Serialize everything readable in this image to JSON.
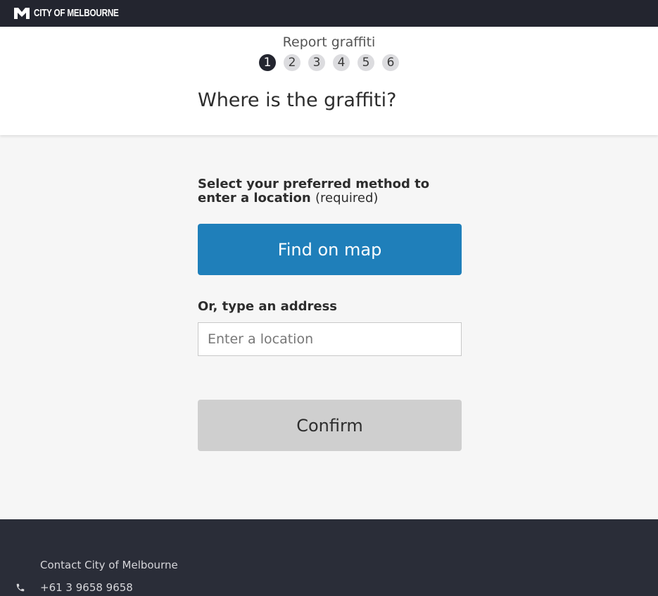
{
  "site": {
    "brand_name": "CITY OF MELBOURNE",
    "logo_icon": "melbourne-m-logo-icon"
  },
  "form": {
    "title": "Report graffiti",
    "steps": [
      "1",
      "2",
      "3",
      "4",
      "5",
      "6"
    ],
    "current_step": 1,
    "question": "Where is the graffiti?"
  },
  "location": {
    "method_label": "Select your preferred method to enter a location",
    "required_note": "(required)",
    "map_button_label": "Find on map",
    "address_label": "Or, type an address",
    "address_placeholder": "Enter a location",
    "address_value": "",
    "confirm_button_label": "Confirm"
  },
  "footer": {
    "contact_heading": "Contact City of Melbourne",
    "phone_icon": "phone-icon",
    "phone_number": "+61 3 9658 9658"
  },
  "colors": {
    "topbar": "#23252f",
    "primary_button": "#1f7fba",
    "confirm_button": "#cfcfcf",
    "footer": "#2a2d38",
    "active_step": "#23252f"
  }
}
